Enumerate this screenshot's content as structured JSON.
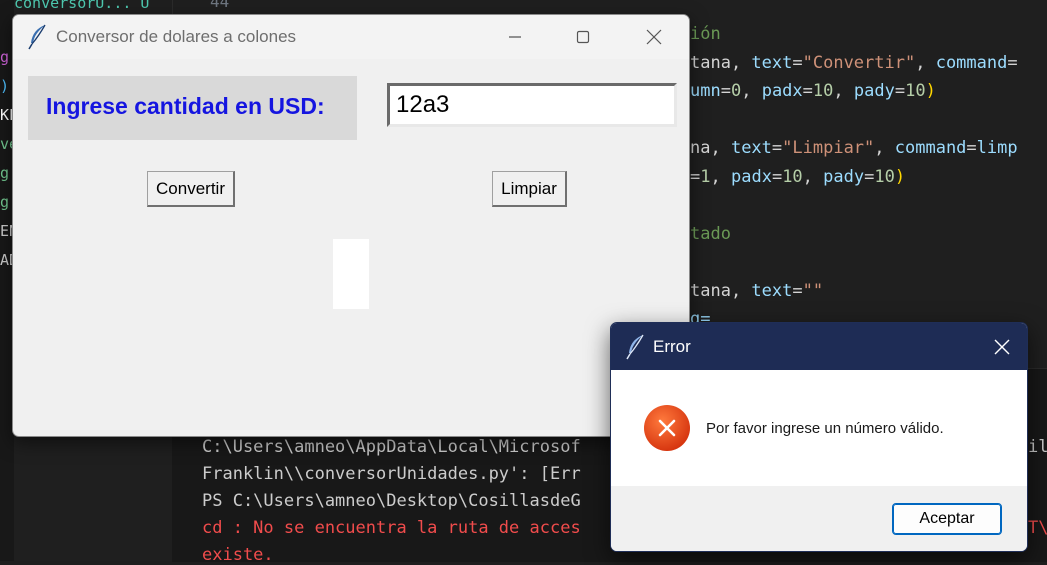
{
  "editor": {
    "line_number": "44",
    "tab_fragment": "conversorU...  U",
    "explorer_fragments": [
      {
        "text": "g",
        "color": "#ce63d9"
      },
      {
        "text": ")",
        "color": "#4fc1ff"
      },
      {
        "text": "KL",
        "color": "#ffffff"
      },
      {
        "text": "ve",
        "color": "#73c991"
      },
      {
        "text": "g",
        "color": "#73c991"
      },
      {
        "text": "g",
        "color": "#73c991"
      },
      {
        "text": "EN",
        "color": "#cccccc"
      },
      {
        "text": "AD",
        "color": "#cccccc"
      }
    ],
    "code_lines": [
      [
        {
          "t": "ión",
          "c": "c-com"
        }
      ],
      [
        {
          "t": "tana, ",
          "c": "c-plain"
        },
        {
          "t": "text",
          "c": "c-kw"
        },
        {
          "t": "=",
          "c": "c-plain"
        },
        {
          "t": "\"Convertir\"",
          "c": "c-str"
        },
        {
          "t": ", ",
          "c": "c-plain"
        },
        {
          "t": "command",
          "c": "c-kw"
        },
        {
          "t": "=",
          "c": "c-plain"
        }
      ],
      [
        {
          "t": "umn",
          "c": "c-kw"
        },
        {
          "t": "=",
          "c": "c-plain"
        },
        {
          "t": "0",
          "c": "c-num"
        },
        {
          "t": ", ",
          "c": "c-plain"
        },
        {
          "t": "padx",
          "c": "c-kw"
        },
        {
          "t": "=",
          "c": "c-plain"
        },
        {
          "t": "10",
          "c": "c-num"
        },
        {
          "t": ", ",
          "c": "c-plain"
        },
        {
          "t": "pady",
          "c": "c-kw"
        },
        {
          "t": "=",
          "c": "c-plain"
        },
        {
          "t": "10",
          "c": "c-num"
        },
        {
          "t": ")",
          "c": "c-par"
        }
      ],
      [],
      [
        {
          "t": "na, ",
          "c": "c-plain"
        },
        {
          "t": "text",
          "c": "c-kw"
        },
        {
          "t": "=",
          "c": "c-plain"
        },
        {
          "t": "\"Limpiar\"",
          "c": "c-str"
        },
        {
          "t": ", ",
          "c": "c-plain"
        },
        {
          "t": "command",
          "c": "c-kw"
        },
        {
          "t": "=",
          "c": "c-plain"
        },
        {
          "t": "limp",
          "c": "c-kw"
        }
      ],
      [
        {
          "t": "=",
          "c": "c-plain"
        },
        {
          "t": "1",
          "c": "c-num"
        },
        {
          "t": ", ",
          "c": "c-plain"
        },
        {
          "t": "padx",
          "c": "c-kw"
        },
        {
          "t": "=",
          "c": "c-plain"
        },
        {
          "t": "10",
          "c": "c-num"
        },
        {
          "t": ", ",
          "c": "c-plain"
        },
        {
          "t": "pady",
          "c": "c-kw"
        },
        {
          "t": "=",
          "c": "c-plain"
        },
        {
          "t": "10",
          "c": "c-num"
        },
        {
          "t": ")",
          "c": "c-par"
        }
      ],
      [],
      [
        {
          "t": "tado",
          "c": "c-com"
        }
      ],
      [],
      [
        {
          "t": "tana, ",
          "c": "c-plain"
        },
        {
          "t": "text",
          "c": "c-kw"
        },
        {
          "t": "=",
          "c": "c-plain"
        },
        {
          "t": "\"\"",
          "c": "c-str"
        }
      ],
      [
        {
          "t": "g=",
          "c": "c-kw"
        }
      ]
    ],
    "terminal_lines": [
      {
        "text": "C:\\Users\\amneo\\AppData\\Local\\Microsof",
        "tail": "il",
        "class": "t-plain"
      },
      {
        "text": "Franklin\\\\conversorUnidades.py': [Err",
        "tail": "",
        "class": "t-plain"
      },
      {
        "text": "PS C:\\Users\\amneo\\Desktop\\CosillasdeG",
        "tail": "",
        "class": "t-plain"
      },
      {
        "text": "cd : No se encuentra la ruta de acces",
        "tail": "T\\",
        "class": "t-err"
      },
      {
        "text": "existe.",
        "tail": "",
        "class": "t-err"
      }
    ]
  },
  "main_window": {
    "title": "Conversor de dolares a colones",
    "label": "Ingrese cantidad en USD:",
    "input_value": "12a3",
    "convert_label": "Convertir",
    "clear_label": "Limpiar",
    "result_text": "",
    "label_color": "#1515e0",
    "icons": [
      "feather-icon",
      "minimize-icon",
      "maximize-icon",
      "close-icon"
    ]
  },
  "error_dialog": {
    "title": "Error",
    "message": "Por favor ingrese un número válido.",
    "accept_label": "Aceptar",
    "icon": "error-x-icon",
    "titlebar_color": "#1e2c55",
    "accent_color": "#0067c0"
  }
}
